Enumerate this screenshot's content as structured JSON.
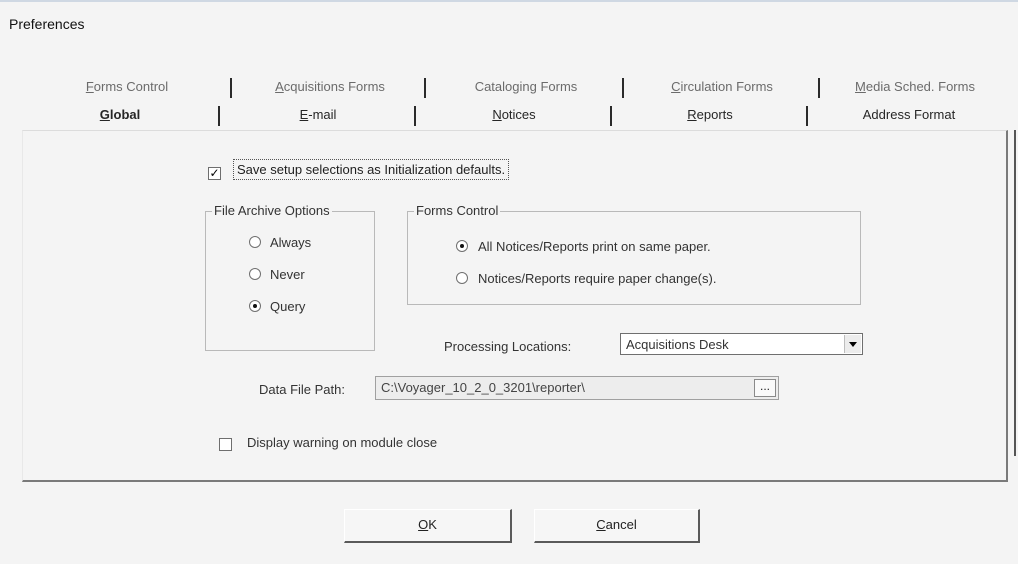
{
  "window": {
    "title": "Preferences"
  },
  "tabs_back": [
    {
      "label": "Forms Control",
      "mn": "F",
      "rest": "orms Control"
    },
    {
      "label": "Acquisitions Forms",
      "mn": "A",
      "rest": "cquisitions Forms"
    },
    {
      "label": "Cataloging Forms",
      "mn": "",
      "rest": "Cataloging Forms"
    },
    {
      "label": "Circulation Forms",
      "mn": "C",
      "rest": "irculation Forms"
    },
    {
      "label": "Media Sched. Forms",
      "mn": "M",
      "rest": "edia Sched. Forms"
    }
  ],
  "tabs_front": [
    {
      "label": "Global",
      "mn": "G",
      "rest": "lobal",
      "active": true
    },
    {
      "label": "E-mail",
      "mn": "E",
      "rest": "-mail"
    },
    {
      "label": "Notices",
      "mn": "N",
      "rest": "otices"
    },
    {
      "label": "Reports",
      "mn": "R",
      "rest": "eports"
    },
    {
      "label": "Address Format",
      "mn": "",
      "rest": "Address Format"
    }
  ],
  "global": {
    "save_defaults": {
      "label": "Save setup selections as Initialization defaults.",
      "checked": true,
      "check_glyph": "✓"
    },
    "archive": {
      "legend": "File Archive Options",
      "options": [
        {
          "label": "Always",
          "selected": false
        },
        {
          "label": "Never",
          "selected": false
        },
        {
          "label": "Query",
          "selected": true
        }
      ]
    },
    "forms_control": {
      "legend": "Forms Control",
      "options": [
        {
          "label": "All Notices/Reports print on same paper.",
          "selected": true
        },
        {
          "label": "Notices/Reports require paper change(s).",
          "selected": false
        }
      ]
    },
    "processing_locations": {
      "label": "Processing Locations:",
      "value": "Acquisitions Desk"
    },
    "data_file_path": {
      "label": "Data File Path:",
      "value": "C:\\Voyager_10_2_0_3201\\reporter\\",
      "browse": "..."
    },
    "display_warning": {
      "label": "Display warning on module close",
      "checked": false
    }
  },
  "buttons": {
    "ok": {
      "mn": "O",
      "rest": "K"
    },
    "cancel": {
      "mn": "C",
      "rest": "ancel"
    }
  }
}
